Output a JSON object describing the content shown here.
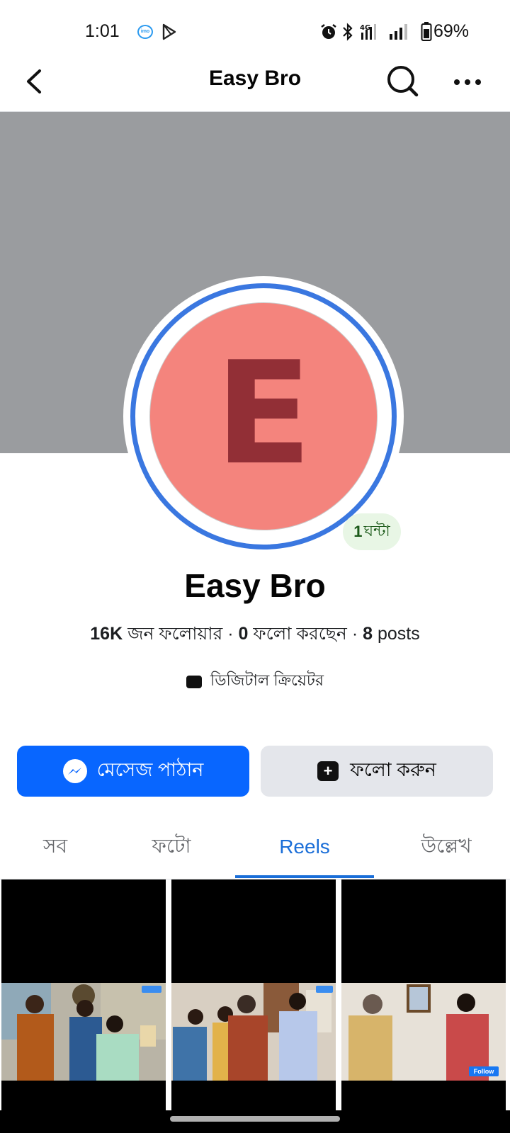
{
  "status_bar": {
    "time": "1:01",
    "imo_label": "imo",
    "battery": "69%"
  },
  "header": {
    "title": "Easy Bro"
  },
  "profile": {
    "avatar_letter": "E",
    "story_time_number": "1",
    "story_time_unit": "ঘন্টা",
    "name": "Easy Bro",
    "followers_count": "16K",
    "followers_label": "জন ফলোয়ার",
    "following_count": "0",
    "following_label": "ফলো করছেন",
    "posts_count": "8",
    "posts_label": "posts",
    "separator": "·",
    "category": "ডিজিটাল ক্রিয়েটর"
  },
  "actions": {
    "message_label": "মেসেজ পাঠান",
    "follow_label": "ফলো করুন"
  },
  "tabs": [
    {
      "label": "সব"
    },
    {
      "label": "ফটো"
    },
    {
      "label": "Reels",
      "active": true
    },
    {
      "label": "উল্লেখ"
    }
  ],
  "reels": [
    {
      "overlay_label": "Follow"
    },
    {
      "overlay_label": "Follow"
    },
    {
      "overlay_label": "Follow"
    }
  ],
  "colors": {
    "accent": "#0866ff",
    "active_tab": "#1a6ed8",
    "avatar_bg": "#f4847d",
    "avatar_letter": "#922f36",
    "story_ring": "#3a77e0",
    "cover": "#9a9c9f"
  }
}
